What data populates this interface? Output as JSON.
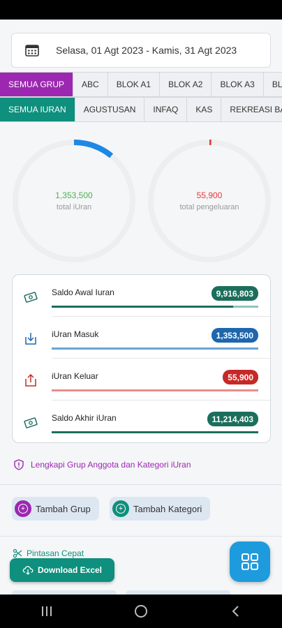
{
  "date_range": "Selasa, 01 Agt 2023 - Kamis, 31 Agt 2023",
  "group_tabs": [
    "SEMUA GRUP",
    "ABC",
    "BLOK A1",
    "BLOK A2",
    "BLOK A3",
    "BL"
  ],
  "category_tabs": [
    "SEMUA IURAN",
    "AGUSTUSAN",
    "INFAQ",
    "KAS",
    "REKREASI BA"
  ],
  "rings": [
    {
      "value": "1,353,500",
      "label": "total iUran",
      "color": "#4caf50",
      "arc_color": "#1e88e5",
      "fraction": 0.11
    },
    {
      "value": "55,900",
      "label": "total pengeluaran",
      "color": "#e53935",
      "arc_color": "#e53935",
      "fraction": 0.005
    }
  ],
  "summary": [
    {
      "label": "Saldo Awal Iuran",
      "value": "9,916,803",
      "badge_color": "#1b6e5c",
      "bar_color": "#1b6e5c",
      "bar_track": "#8fc4bd",
      "fraction": 0.88,
      "icon": "money-icon",
      "icon_color": "#1b6e5c"
    },
    {
      "label": "iUran Masuk",
      "value": "1,353,500",
      "badge_color": "#1e66ad",
      "bar_color": "#6aa4d4",
      "bar_track": "#6aa4d4",
      "fraction": 1.0,
      "icon": "download-icon",
      "icon_color": "#1e66ad"
    },
    {
      "label": "iUran Keluar",
      "value": "55,900",
      "badge_color": "#c62828",
      "bar_color": "#ea8c8c",
      "bar_track": "#ea8c8c",
      "fraction": 1.0,
      "icon": "upload-icon",
      "icon_color": "#c62828"
    },
    {
      "label": "Saldo Akhir iUran",
      "value": "11,214,403",
      "badge_color": "#1b6e5c",
      "bar_color": "#1b6e5c",
      "bar_track": "#1b6e5c",
      "fraction": 1.0,
      "icon": "money-icon",
      "icon_color": "#1b6e5c"
    }
  ],
  "hint_text": "Lengkapi Grup Anggota dan Kategori iUran",
  "add_group_label": "Tambah Grup",
  "add_category_label": "Tambah Kategori",
  "shortcut_label": "Pintasan Cepat",
  "download_label": "Download Excel",
  "colors": {
    "purple": "#9c27b0",
    "teal": "#0f8f7d",
    "blue": "#1e9bdc"
  }
}
